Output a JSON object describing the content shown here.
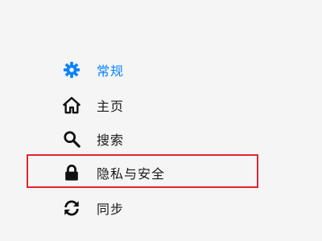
{
  "nav": {
    "items": [
      {
        "id": "general",
        "label": "常规",
        "icon": "gear-icon",
        "active": true
      },
      {
        "id": "home",
        "label": "主页",
        "icon": "home-icon",
        "active": false
      },
      {
        "id": "search",
        "label": "搜索",
        "icon": "search-icon",
        "active": false
      },
      {
        "id": "privacy",
        "label": "隐私与安全",
        "icon": "lock-icon",
        "active": false
      },
      {
        "id": "sync",
        "label": "同步",
        "icon": "sync-icon",
        "active": false
      }
    ]
  },
  "colors": {
    "accent": "#0a84ff",
    "text": "#1a1a1a",
    "icon": "#111111",
    "highlight_border": "#e0262e",
    "background": "#f5f5f5"
  }
}
